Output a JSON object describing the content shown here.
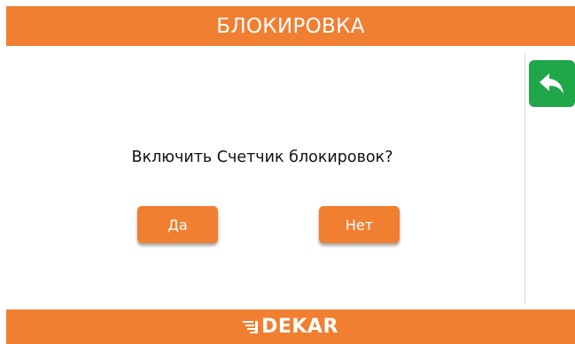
{
  "header": {
    "title": "БЛОКИРОВКА"
  },
  "dialog": {
    "question": "Включить Счетчик блокировок?",
    "yes_label": "Да",
    "no_label": "Нет"
  },
  "back_button": {
    "icon": "reply-arrow-icon"
  },
  "footer": {
    "logo_text": "DEKAR"
  },
  "colors": {
    "accent": "#f07f32",
    "back_button": "#1fa74a",
    "text": "#111111"
  }
}
